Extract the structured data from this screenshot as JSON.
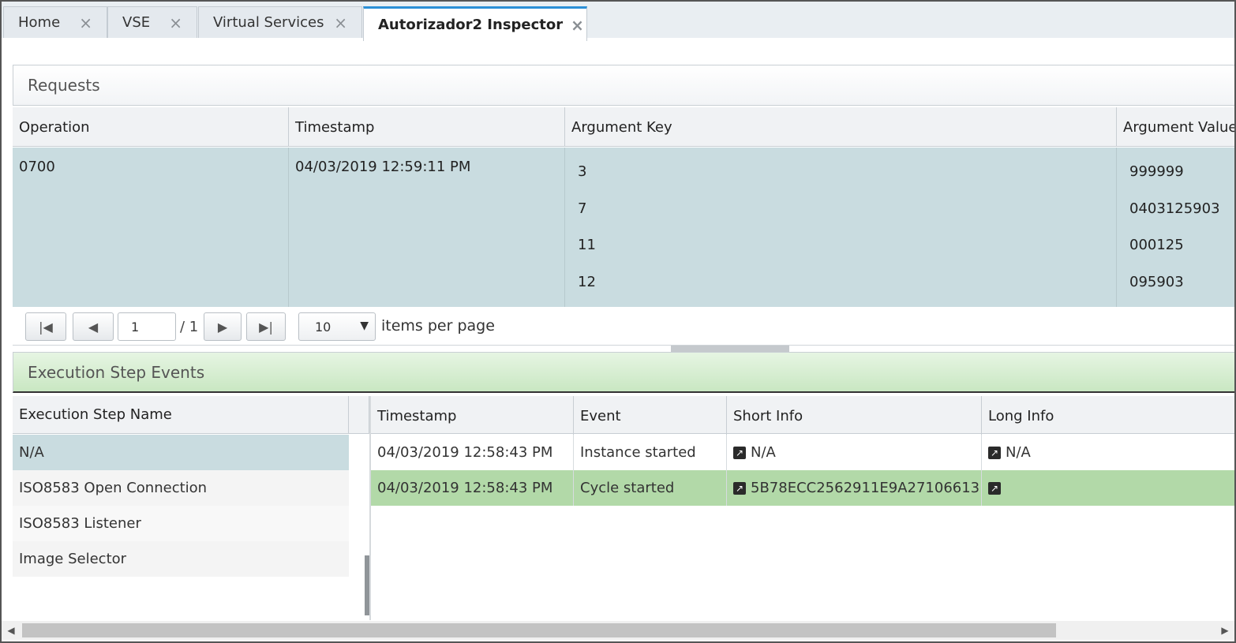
{
  "tabs": [
    {
      "label": "Home",
      "close": "×"
    },
    {
      "label": "VSE",
      "close": "×"
    },
    {
      "label": "Virtual Services",
      "close": "×"
    },
    {
      "label": "Autorizador2 Inspector",
      "close": "×",
      "active": true
    }
  ],
  "requests": {
    "title": "Requests",
    "columns": [
      "Operation",
      "Timestamp",
      "Argument Key",
      "Argument Values"
    ],
    "row": {
      "operation": "0700",
      "timestamp": "04/03/2019 12:59:11 PM",
      "argument_keys": [
        "3",
        "7",
        "11",
        "12"
      ],
      "argument_values": [
        "999999",
        "0403125903",
        "000125",
        "095903"
      ]
    },
    "pager": {
      "first_icon": "first-page-icon",
      "prev_icon": "prev-page-icon",
      "next_icon": "next-page-icon",
      "last_icon": "last-page-icon",
      "current_page": "1",
      "of_text": "/ 1",
      "items_per_page_value": "10",
      "items_per_page_label": "items per page"
    }
  },
  "execution": {
    "title": "Execution Step Events",
    "steps_column": "Execution Step Name",
    "steps": [
      "N/A",
      "ISO8583 Open Connection",
      "ISO8583 Listener",
      "Image Selector"
    ],
    "selected_step": "N/A",
    "events_columns": [
      "Timestamp",
      "Event",
      "Short Info",
      "Long Info"
    ],
    "events": [
      {
        "timestamp": "04/03/2019 12:58:43 PM",
        "event": "Instance started",
        "short_info": "N/A",
        "long_info": "N/A"
      },
      {
        "timestamp": "04/03/2019 12:58:43 PM",
        "event": "Cycle started",
        "short_info": "5B78ECC2562911E9A27106613...",
        "long_info": ""
      }
    ]
  },
  "colors": {
    "tab_accent": "#2b8fd6",
    "selected_row": "#c9dce0",
    "highlight_row": "#b2d9a8",
    "exec_header": "#c9e7c2"
  }
}
